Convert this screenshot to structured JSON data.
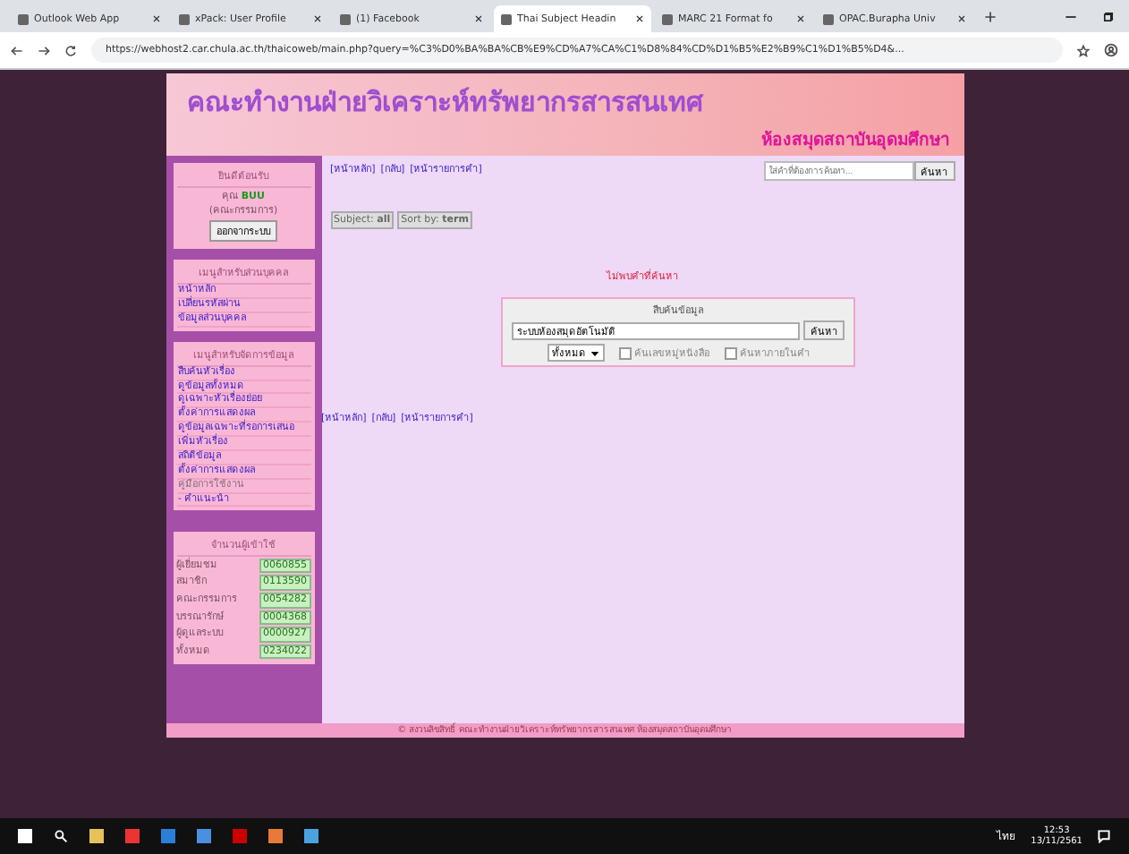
{
  "browser": {
    "tabs": [
      {
        "label": "Outlook Web App",
        "selected": false
      },
      {
        "label": "xPack: User Profile",
        "selected": false
      },
      {
        "label": "(1) Facebook",
        "selected": false
      },
      {
        "label": "Thai Subject Headin",
        "selected": true
      },
      {
        "label": "MARC 21 Format fo",
        "selected": false
      },
      {
        "label": "OPAC.Burapha Univ",
        "selected": false
      }
    ],
    "address": "https://webhost2.car.chula.ac.th/thaicoweb/main.php?query=%C3%D0%BA%BA%CB%E9%CD%A7%CA%C1%D8%84%CD%D1%B5%E2%B9%C1%D1%B5%D4&..."
  },
  "header": {
    "title": "คณะทำงานฝ่ายวิเคราะห์ทรัพยากรสารสนเทศ",
    "subtitle": "ห้องสมุดสถาบันอุดมศึกษา"
  },
  "sidebar": {
    "welcome": {
      "title": "ยินดีต้อนรับ",
      "user_prefix": "คุณ",
      "user": "BUU",
      "role": "(คณะกรรมการ)",
      "logout": "ออกจากระบบ"
    },
    "menus": [
      {
        "title": "เมนูสำหรับส่วนบุคคล",
        "items": [
          {
            "label": "หน้าหลัก",
            "disabled": false
          },
          {
            "label": "เปลี่ยนรหัสผ่าน",
            "disabled": false
          },
          {
            "label": "ข้อมูลส่วนบุคคล",
            "disabled": false
          }
        ]
      },
      {
        "title": "เมนูสำหรับจัดการข้อมูล",
        "items": [
          {
            "label": "สืบค้นหัวเรื่อง",
            "disabled": false
          },
          {
            "label": "ดูข้อมูลทั้งหมด",
            "disabled": false
          },
          {
            "label": "ดูเฉพาะหัวเรื่องย่อย",
            "disabled": false
          },
          {
            "label": "ตั้งค่าการแสดงผล",
            "disabled": false
          },
          {
            "label": "ดูข้อมูลเฉพาะที่รอการเสนอ",
            "disabled": false
          },
          {
            "label": "เพิ่มหัวเรื่อง",
            "disabled": false
          },
          {
            "label": "สถิติข้อมูล",
            "disabled": false
          },
          {
            "label": "ตั้งค่าการแสดงผล",
            "disabled": false
          },
          {
            "label": "คู่มือการใช้งาน",
            "disabled": true
          },
          {
            "label": "- คำแนะนำ",
            "disabled": false
          }
        ]
      }
    ],
    "stats": {
      "title": "จำนวนผู้เข้าใช้",
      "rows": [
        {
          "label": "ผู้เยี่ยมชม",
          "value": "0060855"
        },
        {
          "label": "สมาชิก",
          "value": "0113590"
        },
        {
          "label": "คณะกรรมการ",
          "value": "0054282"
        },
        {
          "label": "บรรณารักษ์",
          "value": "0004368"
        },
        {
          "label": "ผู้ดูแลระบบ",
          "value": "0000927"
        },
        {
          "label": "ทั้งหมด",
          "value": "0234022"
        }
      ]
    }
  },
  "main": {
    "nav_links": [
      "[หน้าหลัก]",
      "[กลับ]",
      "[หน้ารายการคำ]"
    ],
    "quick_search": {
      "placeholder": "ใส่คำที่ต้องการค้นหา...",
      "button": "ค้นหา"
    },
    "filters": [
      {
        "label": "Subject:",
        "value": "all"
      },
      {
        "label": "Sort by:",
        "value": "term"
      }
    ],
    "message": "ไม่พบคำที่ค้นหา",
    "search_box": {
      "title": "สืบค้นข้อมูล",
      "value": "ระบบห้องสมุดอัตโนมัติ",
      "button": "ค้นหา",
      "scope": "ทั้งหมด",
      "options": [
        {
          "label": "ค้นเลขหมู่หนังสือ",
          "checked": false
        },
        {
          "label": "ค้นหาภายในคำ",
          "checked": false
        }
      ]
    },
    "bottom_links": [
      "[หน้าหลัก]",
      "[กลับ]",
      "[หน้ารายการคำ]"
    ]
  },
  "footer": "© สงวนลิขสิทธิ์ คณะทำงานฝ่ายวิเคราะห์ทรัพยากรสารสนเทศ ห้องสมุดสถาบันอุดมศึกษา",
  "taskbar": {
    "language": "ไทย",
    "time": "12:53",
    "date": "13/11/2561"
  }
}
